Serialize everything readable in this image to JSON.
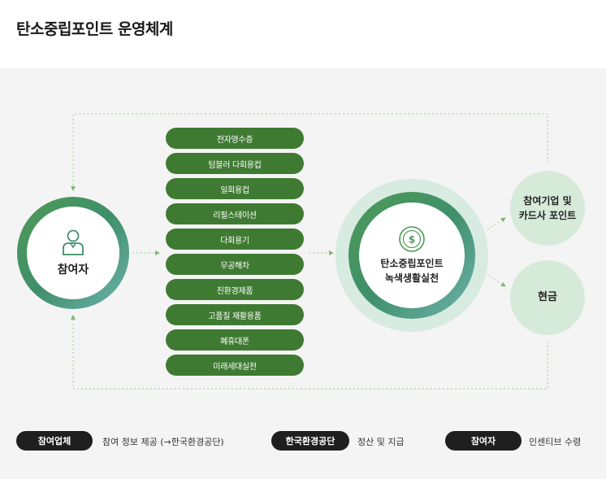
{
  "title": "탄소중립포인트 운영체계",
  "participant": {
    "label": "참여자",
    "icon": "person-icon"
  },
  "activities": [
    "전자영수증",
    "텀블러 다회용컵",
    "일회용컵",
    "리필스테이션",
    "다회용기",
    "무공해차",
    "친환경제품",
    "고품질 재활용품",
    "폐휴대폰",
    "미래세대실천"
  ],
  "center": {
    "line1": "탄소중립포인트",
    "line2": "녹색생활실천",
    "icon": "coin-dollar-icon"
  },
  "rewards": {
    "points_line1": "참여기업 및",
    "points_line2": "카드사 포인트",
    "cash": "현금"
  },
  "legend": [
    {
      "badge": "참여업체",
      "text": "참여 정보 제공 (→한국환경공단)"
    },
    {
      "badge": "한국환경공단",
      "text": "정산 및 지급"
    },
    {
      "badge": "참여자",
      "text": "인센티브 수령"
    }
  ],
  "colors": {
    "pill_green": "#3f7a32",
    "ring_green": "#4f9a56",
    "ring_teal": "#6fb3ad",
    "reward_bg": "#d6ead9",
    "badge_dark": "#1f1f1f"
  }
}
